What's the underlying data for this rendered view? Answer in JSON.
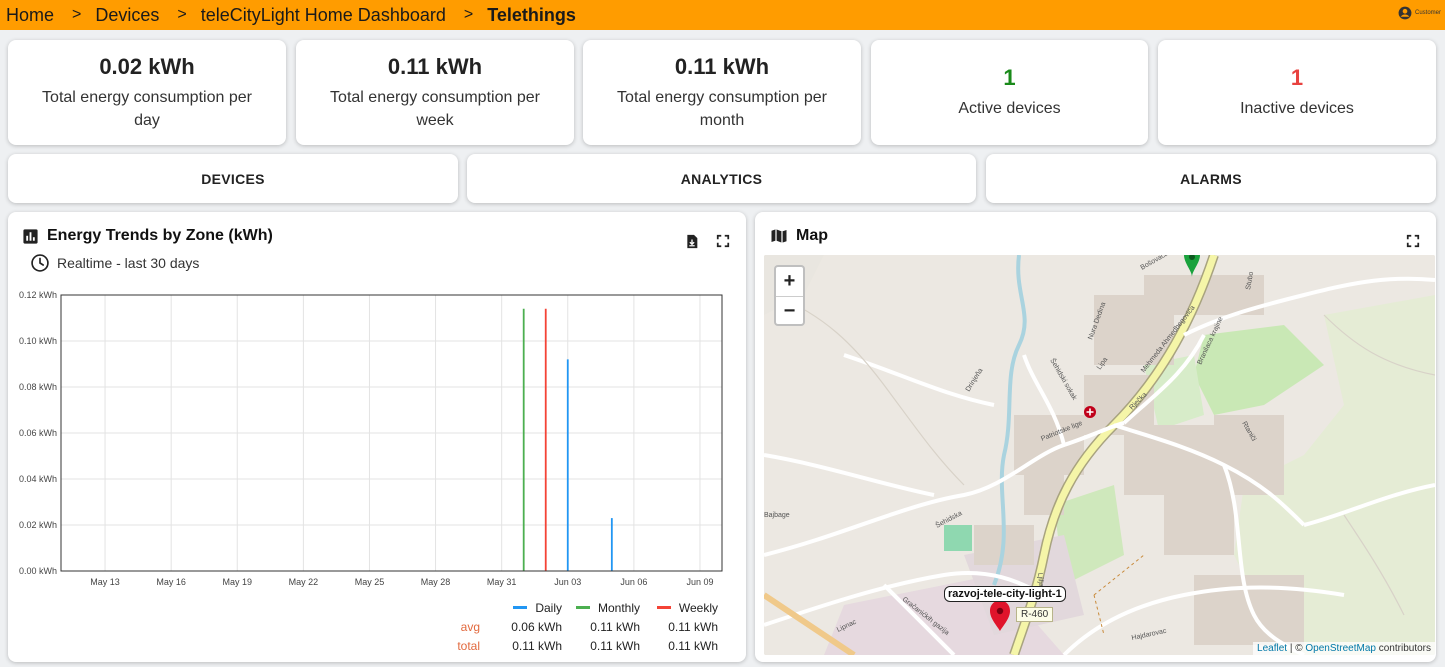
{
  "breadcrumb": {
    "items": [
      {
        "label": "Home",
        "current": false
      },
      {
        "label": "Devices",
        "current": false
      },
      {
        "label": "teleCityLight Home Dashboard",
        "current": false
      },
      {
        "label": "Telethings",
        "current": true
      }
    ],
    "separator": ">"
  },
  "user": {
    "label": "Customer",
    "icon": "account-circle-icon"
  },
  "stats": [
    {
      "value": "0.02 kWh",
      "label": "Total energy consumption per day"
    },
    {
      "value": "0.11 kWh",
      "label": "Total energy consumption per week"
    },
    {
      "value": "0.11 kWh",
      "label": "Total energy consumption per month"
    },
    {
      "value": "1",
      "label": "Active devices",
      "color": "#1a8a1a"
    },
    {
      "value": "1",
      "label": "Inactive devices",
      "color": "#e8423f"
    }
  ],
  "nav": {
    "devices": "DEVICES",
    "analytics": "ANALYTICS",
    "alarms": "ALARMS"
  },
  "chart_panel": {
    "title": "Energy Trends by Zone (kWh)",
    "timewindow": "Realtime - last 30 days",
    "icons": [
      "bar-chart-icon",
      "clock-icon",
      "export-icon",
      "fullscreen-icon"
    ]
  },
  "chart_data": {
    "type": "bar",
    "x_tick_labels": [
      "May 13",
      "May 16",
      "May 19",
      "May 22",
      "May 25",
      "May 28",
      "May 31",
      "Jun 03",
      "Jun 06",
      "Jun 09"
    ],
    "y_tick_labels": [
      "0.00 kWh",
      "0.02 kWh",
      "0.04 kWh",
      "0.06 kWh",
      "0.08 kWh",
      "0.10 kWh",
      "0.12 kWh"
    ],
    "ylim": [
      0,
      0.12
    ],
    "xlim": [
      "2024-05-11",
      "2024-06-10"
    ],
    "grid": true,
    "legend_position": "bottom-right",
    "series": [
      {
        "name": "Daily",
        "color": "#2196f3",
        "points": [
          {
            "x": "2024-06-03",
            "y": 0.092
          },
          {
            "x": "2024-06-05",
            "y": 0.023
          }
        ]
      },
      {
        "name": "Monthly",
        "color": "#4caf50",
        "points": [
          {
            "x": "2024-06-01",
            "y": 0.114
          }
        ]
      },
      {
        "name": "Weekly",
        "color": "#f44336",
        "points": [
          {
            "x": "2024-06-02",
            "y": 0.114
          }
        ]
      }
    ],
    "legend": {
      "row_labels": {
        "avg": "avg",
        "total": "total"
      },
      "columns": [
        {
          "name": "Daily",
          "avg": "0.06 kWh",
          "total": "0.11 kWh"
        },
        {
          "name": "Monthly",
          "avg": "0.11 kWh",
          "total": "0.11 kWh"
        },
        {
          "name": "Weekly",
          "avg": "0.11 kWh",
          "total": "0.11 kWh"
        }
      ]
    }
  },
  "map_panel": {
    "title": "Map",
    "zoom_in": "+",
    "zoom_out": "−",
    "marker_label": "razvoj-tele-city-light-1",
    "road_shield": "R-460",
    "street_labels": [
      "Mehmeda Ahmedbegovića",
      "Rječka",
      "Patriotske lige",
      "Šehidska",
      "Drinjeňa",
      "Bajbage",
      "Lipnac",
      "Gračanićkih gazija",
      "Hajdarovac",
      "Rtaniči",
      "Šehidski sokak",
      "Nura Dedina",
      "Branilaca krajine",
      "Stubo",
      "Ljiljana",
      "Lipa",
      "Bošovača"
    ],
    "attribution": {
      "leaflet": "Leaflet",
      "separator": " | © ",
      "osm": "OpenStreetMap",
      "suffix": " contributors"
    }
  }
}
